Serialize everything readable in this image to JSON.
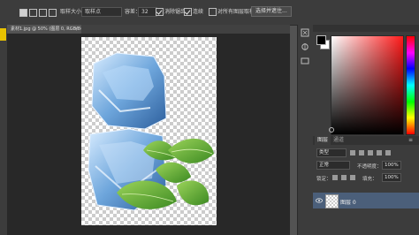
{
  "options_bar": {
    "sample_size_label": "取样大小：",
    "sample_size_value": "取样点",
    "tolerance_label": "容差：",
    "tolerance_value": "32",
    "antialias_label": "消除锯齿",
    "contiguous_label": "连续",
    "all_layers_label": "对所有图层取样",
    "select_subject_button": "选择并遮住..."
  },
  "document_tab": {
    "title": "素材1.jpg @ 50% (图层 0, RGB/8#)",
    "close_glyph": "×"
  },
  "panels": {
    "layers_tab": "图层",
    "channels_tab": "通道",
    "menu_glyph": "≡",
    "kind_filter": "类型",
    "blend_mode": "正常",
    "opacity_label": "不透明度：",
    "opacity_value": "100%",
    "lock_label": "锁定：",
    "fill_label": "填充：",
    "fill_value": "100%",
    "layer_name": "图层 0"
  },
  "colors": {
    "foreground": "#000000",
    "background": "#ffffff",
    "accent_tool_highlight": "#e8c200",
    "selected_layer": "#4b5f7a"
  },
  "icons": {
    "tool_highlight": "magic-wand-icon",
    "history": "history-icon",
    "properties": "properties-icon",
    "visibility": "eye-icon"
  }
}
